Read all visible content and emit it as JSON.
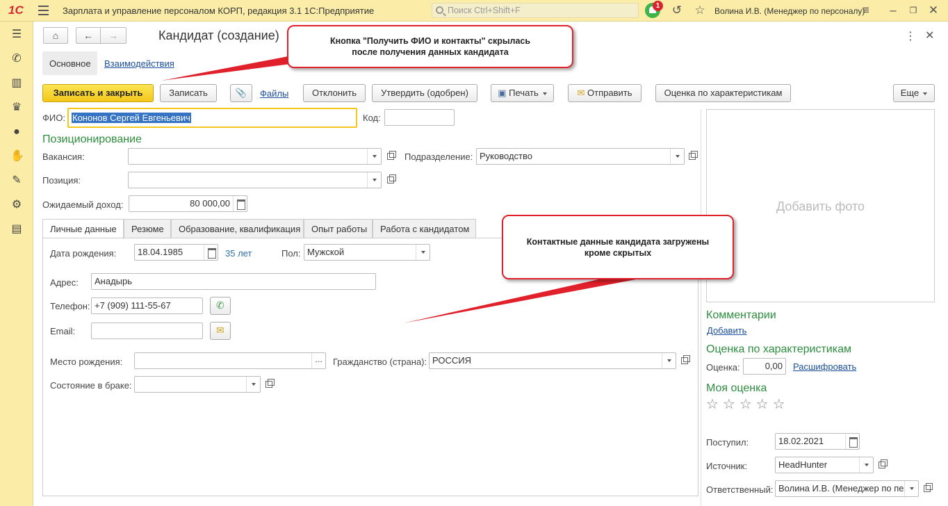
{
  "titlebar": {
    "logo": "1С",
    "app_title": "Зарплата и управление персоналом КОРП, редакция 3.1 1С:Предприятие",
    "search_placeholder": "Поиск Ctrl+Shift+F",
    "notifications_count": "1",
    "user": "Волина И.В. (Менеджер по персоналу)"
  },
  "form": {
    "title": "Кандидат (создание)",
    "tabs": {
      "main": "Основное",
      "interactions": "Взаимодействия"
    },
    "toolbar": {
      "save_close": "Записать и закрыть",
      "save": "Записать",
      "files": "Файлы",
      "reject": "Отклонить",
      "approve": "Утвердить (одобрен)",
      "print": "Печать",
      "send": "Отправить",
      "rate": "Оценка по характеристикам",
      "more": "Еще"
    },
    "fio": {
      "label": "ФИО:",
      "value": "Кононов Сергей Евгеньевич"
    },
    "code": {
      "label": "Код:",
      "value": ""
    },
    "positioning": {
      "header": "Позиционирование",
      "vacancy_label": "Вакансия:",
      "vacancy_value": "",
      "division_label": "Подразделение:",
      "division_value": "Руководство",
      "position_label": "Позиция:",
      "position_value": "",
      "income_label": "Ожидаемый доход:",
      "income_value": "80 000,00"
    },
    "inner_tabs": [
      "Личные данные",
      "Резюме",
      "Образование, квалификация",
      "Опыт работы",
      "Работа с кандидатом"
    ],
    "personal": {
      "birth_label": "Дата рождения:",
      "birth_value": "18.04.1985",
      "age": "35 лет",
      "sex_label": "Пол:",
      "sex_value": "Мужской",
      "address_label": "Адрес:",
      "address_value": "Анадырь",
      "phone_label": "Телефон:",
      "phone_value": "+7 (909) 111-55-67",
      "email_label": "Email:",
      "email_value": "",
      "birthplace_label": "Место рождения:",
      "birthplace_value": "",
      "citizenship_label": "Гражданство (страна):",
      "citizenship_value": "РОССИЯ",
      "marital_label": "Состояние в браке:",
      "marital_value": ""
    },
    "side": {
      "add_photo": "Добавить фото",
      "comments_header": "Комментарии",
      "comments_add": "Добавить",
      "rating_header": "Оценка по характеристикам",
      "rating_label": "Оценка:",
      "rating_value": "0,00",
      "rating_decode": "Расшифровать",
      "my_rating_header": "Моя оценка",
      "stars": "☆☆☆☆☆",
      "received_label": "Поступил:",
      "received_value": "18.02.2021",
      "source_label": "Источник:",
      "source_value": "HeadHunter",
      "responsible_label": "Ответственный:",
      "responsible_value": "Волина И.В. (Менеджер по пе"
    }
  },
  "callouts": {
    "top": "Кнопка \"Получить ФИО и контакты\" скрылась после получения данных кандидата",
    "middle": "Контактные данные кандидата загружены кроме скрытых"
  },
  "colors": {
    "accent_yellow": "#fbeda8",
    "primary_button": "#f4c71a",
    "section_green": "#2d8d3e",
    "callout_border": "#e0202a"
  }
}
